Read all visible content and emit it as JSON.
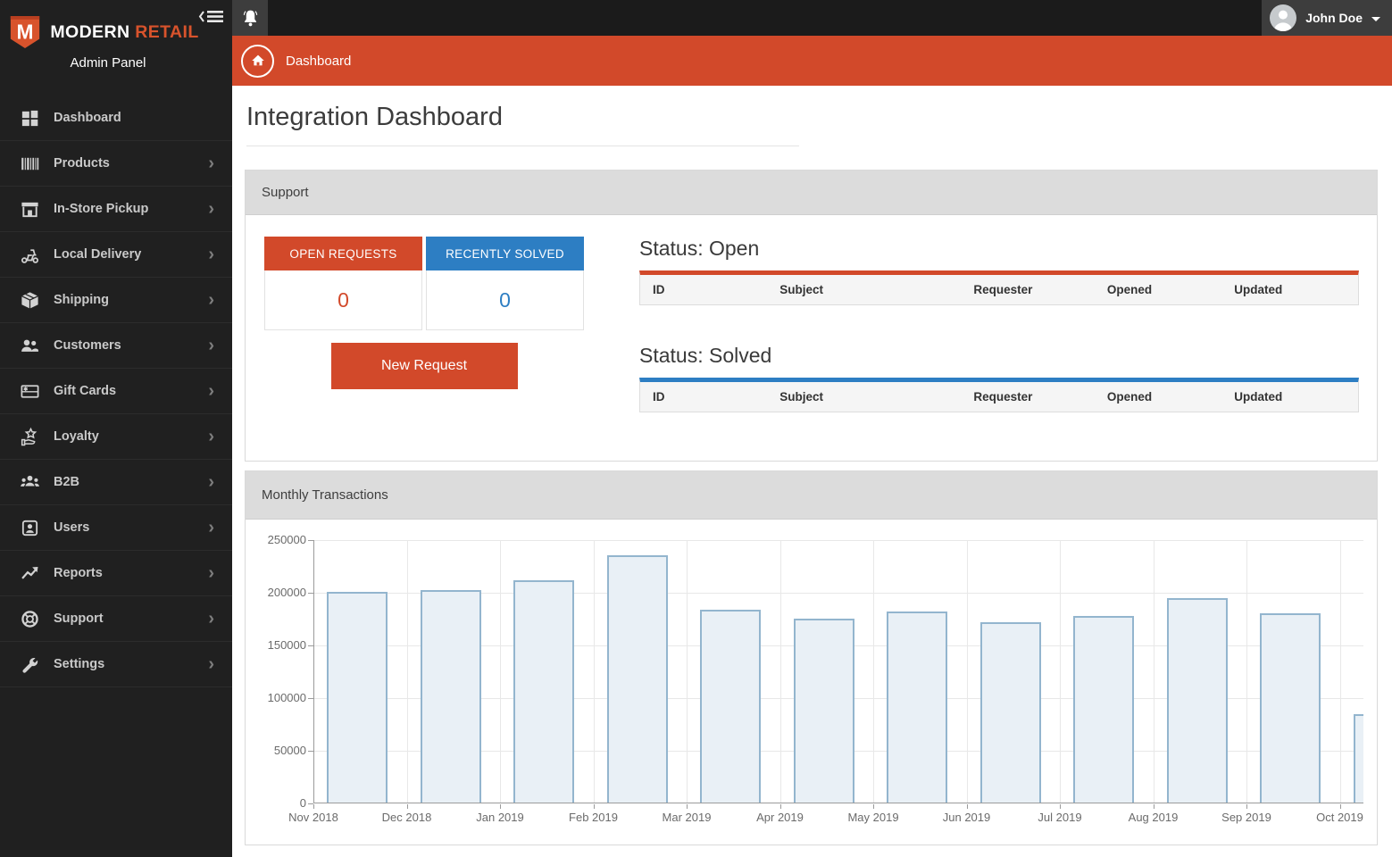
{
  "brand": {
    "name_primary": "MODERN",
    "name_accent": "RETAIL",
    "subtitle": "Admin Panel"
  },
  "topbar": {
    "user_name": "John Doe"
  },
  "breadcrumb": {
    "label": "Dashboard"
  },
  "page": {
    "title": "Integration Dashboard"
  },
  "sidebar": {
    "items": [
      {
        "label": "Dashboard",
        "icon": "dashboard-icon",
        "has_submenu": false
      },
      {
        "label": "Products",
        "icon": "barcode-icon",
        "has_submenu": true
      },
      {
        "label": "In-Store Pickup",
        "icon": "store-icon",
        "has_submenu": true
      },
      {
        "label": "Local Delivery",
        "icon": "scooter-icon",
        "has_submenu": true
      },
      {
        "label": "Shipping",
        "icon": "package-icon",
        "has_submenu": true
      },
      {
        "label": "Customers",
        "icon": "customers-icon",
        "has_submenu": true
      },
      {
        "label": "Gift Cards",
        "icon": "gift-card-icon",
        "has_submenu": true
      },
      {
        "label": "Loyalty",
        "icon": "loyalty-icon",
        "has_submenu": true
      },
      {
        "label": "B2B",
        "icon": "group-icon",
        "has_submenu": true
      },
      {
        "label": "Users",
        "icon": "user-badge-icon",
        "has_submenu": true
      },
      {
        "label": "Reports",
        "icon": "trend-up-icon",
        "has_submenu": true
      },
      {
        "label": "Support",
        "icon": "life-ring-icon",
        "has_submenu": true
      },
      {
        "label": "Settings",
        "icon": "wrench-icon",
        "has_submenu": true
      }
    ]
  },
  "support": {
    "panel_title": "Support",
    "stats": [
      {
        "label": "OPEN REQUESTS",
        "value": "0",
        "color": "#d2492a"
      },
      {
        "label": "RECENTLY SOLVED",
        "value": "0",
        "color": "#2d7ec3"
      }
    ],
    "new_request_label": "New Request",
    "tables": [
      {
        "title": "Status: Open",
        "accent": "#d2492a",
        "columns": [
          "ID",
          "Subject",
          "Requester",
          "Opened",
          "Updated"
        ],
        "rows": []
      },
      {
        "title": "Status: Solved",
        "accent": "#2d7ec3",
        "columns": [
          "ID",
          "Subject",
          "Requester",
          "Opened",
          "Updated"
        ],
        "rows": []
      }
    ]
  },
  "transactions": {
    "panel_title": "Monthly Transactions"
  },
  "chart_data": {
    "type": "bar",
    "title": "Monthly Transactions",
    "categories": [
      "Nov 2018",
      "Dec 2018",
      "Jan 2019",
      "Feb 2019",
      "Mar 2019",
      "Apr 2019",
      "May 2019",
      "Jun 2019",
      "Jul 2019",
      "Aug 2019",
      "Sep 2019",
      "Oct 2019"
    ],
    "values": [
      200000,
      202000,
      211000,
      235000,
      183000,
      175000,
      181000,
      171000,
      177000,
      194000,
      180000,
      84000
    ],
    "xlabel": "",
    "ylabel": "",
    "ylim": [
      0,
      250000
    ],
    "ytick_step": 50000,
    "grid": true,
    "legend": "none",
    "bar_fill": "#e9f0f6",
    "bar_border": "#93b5ce",
    "note": "last bar (Oct 2019) is clipped by right edge of plot area"
  },
  "colors": {
    "accent_orange": "#d2492a",
    "accent_blue": "#2d7ec3"
  }
}
